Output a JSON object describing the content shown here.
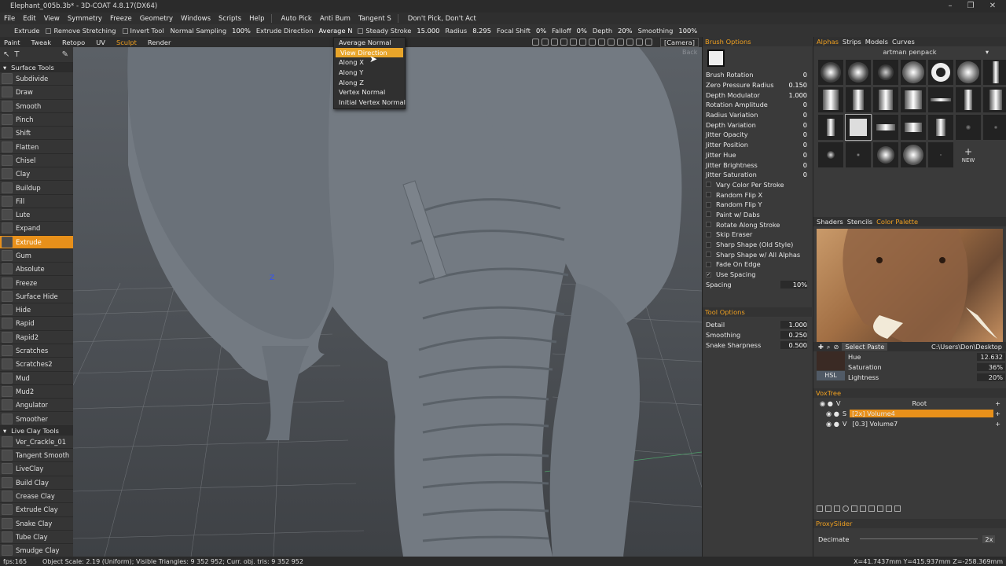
{
  "window": {
    "title": "Elephant_005b.3b* - 3D-COAT 4.8.17(DX64)"
  },
  "menu": [
    "File",
    "Edit",
    "View",
    "Symmetry",
    "Freeze",
    "Geometry",
    "Windows",
    "Scripts",
    "Help"
  ],
  "menu_extra": {
    "auto_pick": "Auto Pick",
    "anti_bump": "Anti Bum",
    "tangent": "Tangent S",
    "dont_pick": "Don't Pick, Don't Act"
  },
  "toolbar": {
    "tool_name": "Extrude",
    "remove_stretching": "Remove Stretching",
    "invert_tool": "Invert Tool",
    "normal_sampling": "Normal Sampling",
    "normal_sampling_val": "100%",
    "extrude_direction": "Extrude Direction",
    "extrude_direction_val": "Average N",
    "steady_stroke": "Steady Stroke",
    "steady_stroke_val": "15.000",
    "radius": "Radius",
    "radius_val": "8.295",
    "focal_shift": "Focal Shift",
    "focal_shift_val": "0%",
    "falloff": "Falloff",
    "falloff_val": "0%",
    "depth": "Depth",
    "depth_val": "20%",
    "smoothing": "Smoothing",
    "smoothing_val": "100%"
  },
  "rooms": [
    {
      "label": "Paint",
      "active": false
    },
    {
      "label": "Tweak",
      "active": false
    },
    {
      "label": "Retopo",
      "active": false
    },
    {
      "label": "UV",
      "active": false
    },
    {
      "label": "Sculpt",
      "active": true
    },
    {
      "label": "Render",
      "active": false
    }
  ],
  "camera_label": "[Camera]",
  "dropdown": {
    "items": [
      "Average Normal",
      "View Direction",
      "Along X",
      "Along Y",
      "Along Z",
      "Vertex Normal",
      "Initial Vertex Normal"
    ],
    "highlighted": 1
  },
  "left": {
    "surface_tools_header": "Surface Tools",
    "surface_tools": [
      "Subdivide",
      "Draw",
      "Smooth",
      "Pinch",
      "Shift",
      "Flatten",
      "Chisel",
      "Clay",
      "Buildup",
      "Fill",
      "Lute",
      "Expand",
      "Extrude",
      "Gum",
      "Absolute",
      "Freeze",
      "Surface Hide",
      "Hide",
      "Rapid",
      "Rapid2",
      "Scratches",
      "Scratches2",
      "Mud",
      "Mud2",
      "Angulator",
      "Smoother"
    ],
    "selected": "Extrude",
    "live_clay_header": "Live Clay Tools",
    "live_clay_tools": [
      "Ver_Crackle_01",
      "Tangent Smooth",
      "LiveClay",
      "Build Clay",
      "Crease Clay",
      "Extrude Clay",
      "Snake Clay",
      "Tube Clay",
      "Smudge Clay"
    ]
  },
  "viewport": {
    "axis_z": "Z",
    "back_label": "Back"
  },
  "brush_options": {
    "header": "Brush Options",
    "params": [
      {
        "label": "Brush Rotation",
        "value": "0"
      },
      {
        "label": "Zero Pressure Radius",
        "value": "0.150"
      },
      {
        "label": "Depth Modulator",
        "value": "1.000"
      },
      {
        "label": "Rotation Amplitude",
        "value": "0"
      },
      {
        "label": "Radius Variation",
        "value": "0"
      },
      {
        "label": "Depth Variation",
        "value": "0"
      },
      {
        "label": "Jitter Opacity",
        "value": "0"
      },
      {
        "label": "Jitter Position",
        "value": "0"
      },
      {
        "label": "Jitter Hue",
        "value": "0"
      },
      {
        "label": "Jitter Brightness",
        "value": "0"
      },
      {
        "label": "Jitter Saturation",
        "value": "0"
      }
    ],
    "checks": [
      {
        "label": "Vary Color Per Stroke",
        "checked": false
      },
      {
        "label": "Random Flip X",
        "checked": false
      },
      {
        "label": "Random Flip Y",
        "checked": false
      },
      {
        "label": "Paint w/ Dabs",
        "checked": false
      },
      {
        "label": "Rotate Along Stroke",
        "checked": false
      },
      {
        "label": "Skip Eraser",
        "checked": false
      },
      {
        "label": "Sharp Shape (Old Style)",
        "checked": false
      },
      {
        "label": "Sharp Shape w/ All Alphas",
        "checked": false
      },
      {
        "label": "Fade On Edge",
        "checked": false
      },
      {
        "label": "Use Spacing",
        "checked": true
      }
    ],
    "spacing_label": "Spacing",
    "spacing_val": "10%"
  },
  "tool_options": {
    "header": "Tool Options",
    "params": [
      {
        "label": "Detail",
        "value": "1.000"
      },
      {
        "label": "Smoothing",
        "value": "0.250"
      },
      {
        "label": "Snake Sharpness",
        "value": "0.500"
      }
    ]
  },
  "right": {
    "tabs_top": [
      {
        "label": "Alphas",
        "active": true
      },
      {
        "label": "Strips",
        "active": false
      },
      {
        "label": "Models",
        "active": false
      },
      {
        "label": "Curves",
        "active": false
      }
    ],
    "alpha_set": "artman penpack",
    "new_label": "NEW",
    "tabs_mid": [
      {
        "label": "Shaders",
        "active": false
      },
      {
        "label": "Stencils",
        "active": false
      },
      {
        "label": "Color Palette",
        "active": true
      }
    ],
    "select_paste": "Select Paste",
    "path": "C:\\Users\\Don\\Desktop",
    "hsl_label": "HSL",
    "hsl": [
      {
        "label": "Hue",
        "value": "12.632"
      },
      {
        "label": "Saturation",
        "value": "36%"
      },
      {
        "label": "Lightness",
        "value": "20%"
      }
    ],
    "voxtree_header": "VoxTree",
    "voxtree": [
      {
        "flag": "V",
        "name": "Root",
        "selected": false
      },
      {
        "flag": "S",
        "name": "[2x] Volume4",
        "selected": true
      },
      {
        "flag": "V",
        "name": "[0.3] Volume7",
        "selected": false
      }
    ],
    "proxy_header": "ProxySlider",
    "decimate_label": "Decimate",
    "decimate_val": "2x"
  },
  "status": {
    "fps": "fps:165",
    "info": "Object Scale: 2.19 (Uniform); Visible Triangles: 9 352 952; Curr. obj. tris: 9 352 952",
    "coords": "X=41.7437mm Y=415.937mm Z=-258.369mm"
  },
  "colors": {
    "accent": "#e8901a",
    "panel": "#3a3a3a",
    "bg_dark": "#2b2b2b"
  }
}
